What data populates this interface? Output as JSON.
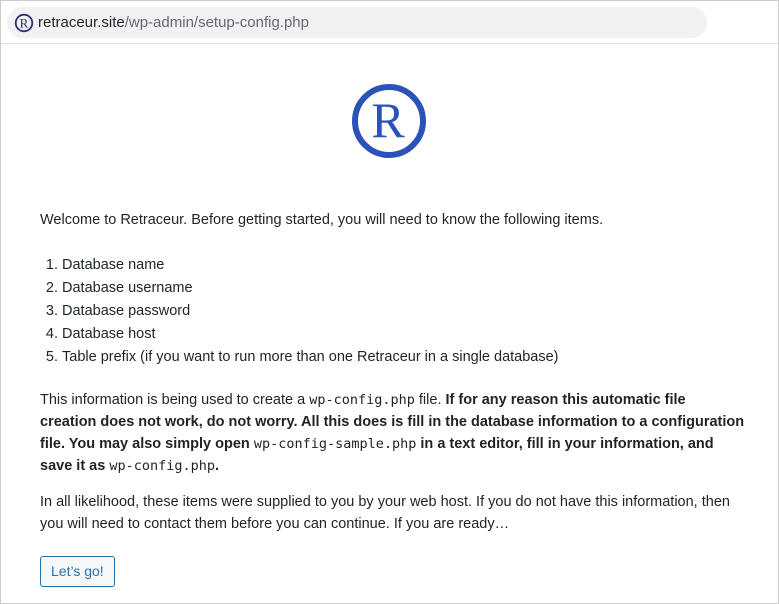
{
  "browser": {
    "url_host": "retraceur.site",
    "url_path": "/wp-admin/setup-config.php",
    "favicon_icon": "retraceur-logo-icon"
  },
  "logo": {
    "icon": "retraceur-logo-icon",
    "color": "#2c52b8"
  },
  "setup": {
    "intro": "Welcome to Retraceur. Before getting started, you will need to know the following items.",
    "items": [
      "Database name",
      "Database username",
      "Database password",
      "Database host",
      "Table prefix (if you want to run more than one Retraceur in a single database)"
    ],
    "info": {
      "part1": "This information is being used to create a ",
      "file1": "wp-config.php",
      "part2": " file. ",
      "bold1": "If for any reason this automatic file creation does not work, do not worry. All this does is fill in the database information to a configuration file. You may also simply open ",
      "file2": "wp-config-sample.php",
      "bold2": " in a text editor, fill in your information, and save it as ",
      "file3": "wp-config.php",
      "bold3": "."
    },
    "likelihood": "In all likelihood, these items were supplied to you by your web host. If you do not have this information, then you will need to contact them before you can continue. If you are ready…",
    "button_label": "Let’s go!"
  },
  "colors": {
    "accent": "#2271b1",
    "logo": "#2c52b8"
  }
}
